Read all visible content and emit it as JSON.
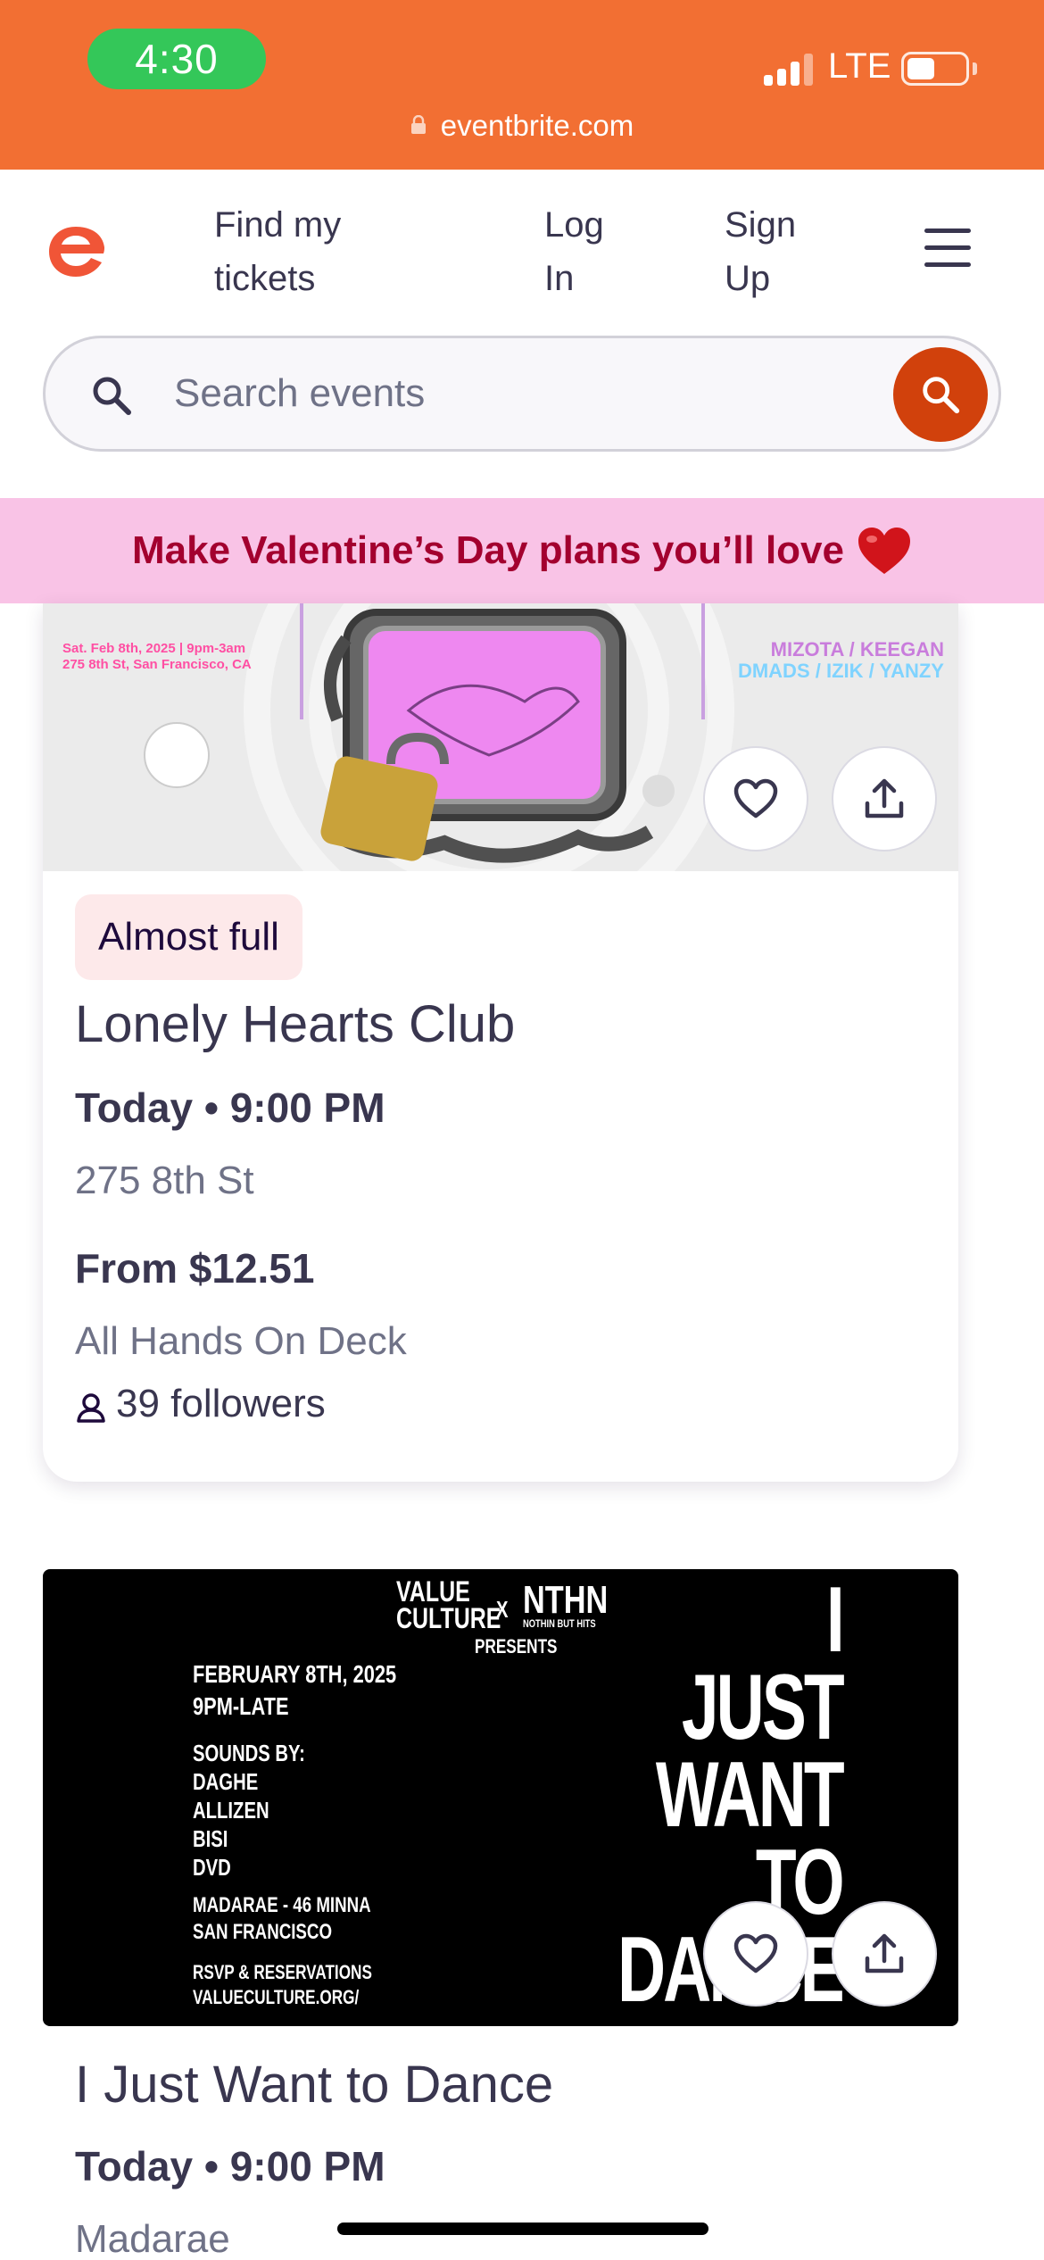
{
  "status_bar": {
    "time": "4:30",
    "network": "LTE",
    "url": "eventbrite.com",
    "bg_color": "#f26f33"
  },
  "header": {
    "logo_icon": "eventbrite-e-logo",
    "find_tickets": "Find my tickets",
    "login": "Log In",
    "signup": "Sign Up",
    "menu_icon": "hamburger-menu-icon"
  },
  "search": {
    "placeholder": "Search events",
    "button_icon": "search-icon"
  },
  "promo": {
    "text": "Make Valentine’s Day plans you’ll love",
    "icon": "red-heart",
    "bg_color": "#f9c3e6"
  },
  "events": [
    {
      "badge": "Almost full",
      "title": "Lonely Hearts Club",
      "datetime": "Today • 9:00 PM",
      "venue": "275 8th St",
      "price": "From $12.51",
      "organizer": "All Hands On Deck",
      "followers": "39 followers",
      "poster": {
        "left_line1": "Sat. Feb 8th, 2025 | 9pm-3am",
        "left_line2": "275 8th St, San Francisco, CA",
        "right_line1": "MIZOTA / KEEGAN",
        "right_line2": "DMADS / IZIK / YANZY"
      }
    },
    {
      "title": "I Just Want to Dance",
      "datetime": "Today • 9:00 PM",
      "venue": "Madarae",
      "poster": {
        "brand_left": "VALUE CULTURE",
        "x": "X",
        "brand_right": "NTHN",
        "brand_right_sub": "NOTHIN BUT HITS",
        "presents": "PRESENTS",
        "date_line1": "FEBRUARY 8TH, 2025",
        "date_line2": "9PM-LATE",
        "sounds_by": "SOUNDS BY:",
        "artists": [
          "DAGHE",
          "ALLIZEN",
          "BISI",
          "DVD"
        ],
        "venue_line1": "MADARAE - 46 MINNA",
        "venue_line2": "SAN FRANCISCO",
        "rsvp_line1": "RSVP & RESERVATIONS",
        "rsvp_line2": "VALUECULTURE.ORG/",
        "big_title": [
          "I",
          "JUST",
          "WANT",
          "TO",
          "DANCE"
        ]
      }
    }
  ]
}
